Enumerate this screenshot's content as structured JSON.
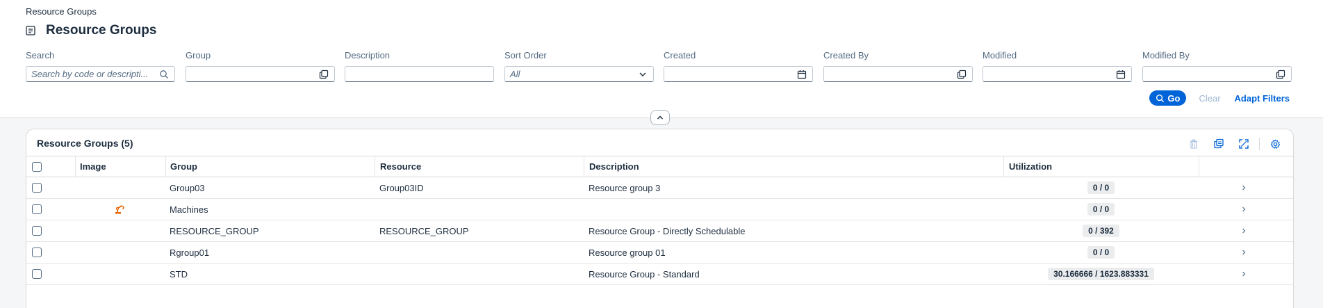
{
  "header": {
    "breadcrumb": "Resource Groups",
    "title": "Resource Groups"
  },
  "filters": {
    "search": {
      "label": "Search",
      "placeholder": "Search by code or descripti..."
    },
    "group": {
      "label": "Group",
      "value": ""
    },
    "description": {
      "label": "Description",
      "value": ""
    },
    "sort_order": {
      "label": "Sort Order",
      "value": "All"
    },
    "created": {
      "label": "Created",
      "value": ""
    },
    "created_by": {
      "label": "Created By",
      "value": ""
    },
    "modified": {
      "label": "Modified",
      "value": ""
    },
    "modified_by": {
      "label": "Modified By",
      "value": ""
    }
  },
  "actions": {
    "go": "Go",
    "clear": "Clear",
    "adapt": "Adapt Filters"
  },
  "table": {
    "title": "Resource Groups (5)",
    "columns": {
      "image": "Image",
      "group": "Group",
      "resource": "Resource",
      "description": "Description",
      "utilization": "Utilization"
    },
    "rows": [
      {
        "group": "Group03",
        "resource": "Group03ID",
        "description": "Resource group 3",
        "utilization": "0 / 0",
        "image": ""
      },
      {
        "group": "Machines",
        "resource": "",
        "description": "",
        "utilization": "0 / 0",
        "image": "robot-arm-icon"
      },
      {
        "group": "RESOURCE_GROUP",
        "resource": "RESOURCE_GROUP",
        "description": "Resource Group - Directly Schedulable",
        "utilization": "0 / 392",
        "image": ""
      },
      {
        "group": "Rgroup01",
        "resource": "",
        "description": "Resource group 01",
        "utilization": "0 / 0",
        "image": ""
      },
      {
        "group": "STD",
        "resource": "",
        "description": "Resource Group - Standard",
        "utilization": "30.166666 / 1623.883331",
        "image": ""
      }
    ]
  },
  "colors": {
    "accent": "#0064d9",
    "image_icon": "#e76500"
  }
}
